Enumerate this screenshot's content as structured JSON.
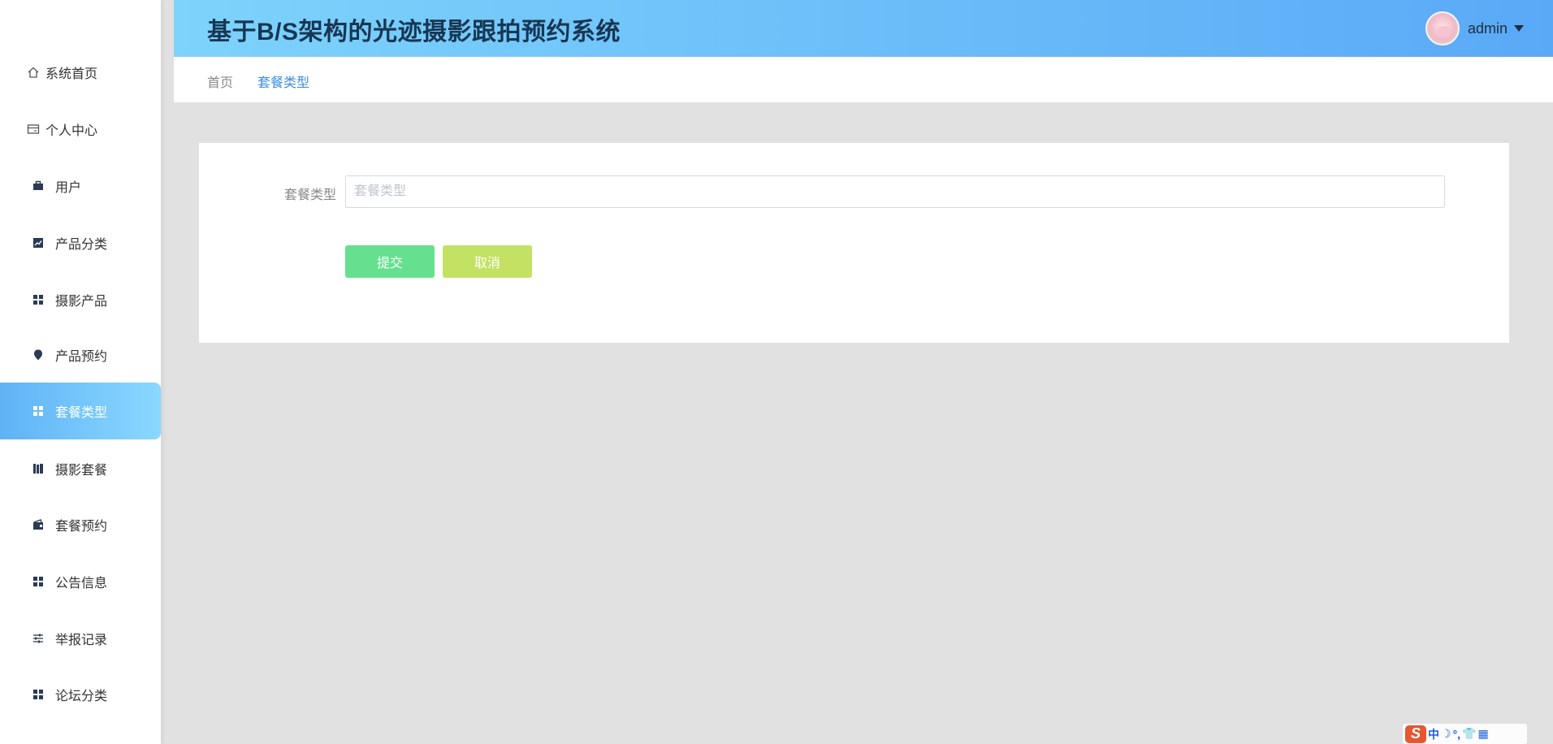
{
  "app": {
    "title": "基于B/S架构的光迹摄影跟拍预约系统"
  },
  "user": {
    "name": "admin"
  },
  "sidebar": {
    "items": [
      {
        "label": "系统首页",
        "icon": "home-icon"
      },
      {
        "label": "个人中心",
        "icon": "id-card-icon"
      },
      {
        "label": "用户",
        "icon": "briefcase-icon"
      },
      {
        "label": "产品分类",
        "icon": "chart-icon"
      },
      {
        "label": "摄影产品",
        "icon": "grid-icon"
      },
      {
        "label": "产品预约",
        "icon": "pin-icon"
      },
      {
        "label": "套餐类型",
        "icon": "grid-icon",
        "active": true
      },
      {
        "label": "摄影套餐",
        "icon": "books-icon"
      },
      {
        "label": "套餐预约",
        "icon": "wallet-icon"
      },
      {
        "label": "公告信息",
        "icon": "grid-icon"
      },
      {
        "label": "举报记录",
        "icon": "sliders-icon"
      },
      {
        "label": "论坛分类",
        "icon": "grid-icon"
      }
    ]
  },
  "breadcrumb": {
    "home": "首页",
    "current": "套餐类型"
  },
  "form": {
    "field_label": "套餐类型",
    "field_placeholder": "套餐类型",
    "field_value": "",
    "submit_label": "提交",
    "cancel_label": "取消"
  },
  "ime": {
    "logo": "S",
    "items": [
      "中",
      "☽",
      "°,",
      "👕",
      "▦"
    ]
  },
  "colors": {
    "header_start": "#7dd3fb",
    "header_end": "#5aa9f7",
    "active_item": "#5fb3f6",
    "submit": "#66e08e",
    "cancel": "#c3e263",
    "link": "#3a8ee6"
  }
}
